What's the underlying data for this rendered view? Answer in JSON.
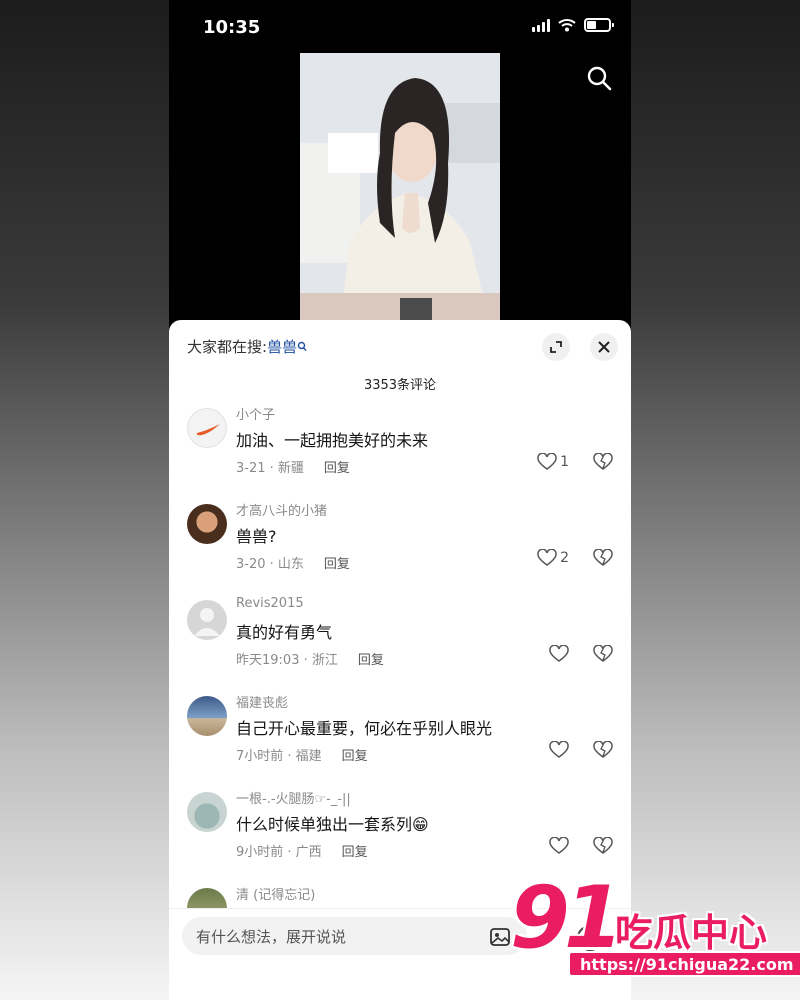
{
  "status_bar": {
    "time": "10:35"
  },
  "sheet": {
    "search_prefix": "大家都在搜:",
    "search_term": "兽兽",
    "comment_count": "3353条评论"
  },
  "comments": [
    {
      "user": "小个子",
      "text": "加油、一起拥抱美好的未来",
      "meta": "3-21 · 新疆",
      "reply": "回复",
      "likes": "1"
    },
    {
      "user": "才高八斗的小猪",
      "text": "兽兽?",
      "meta": "3-20 · 山东",
      "reply": "回复",
      "likes": "2"
    },
    {
      "user": "Revis2015",
      "text": "真的好有勇气",
      "meta": "昨天19:03 · 浙江",
      "reply": "回复",
      "likes": ""
    },
    {
      "user": "福建丧彪",
      "text": "自己开心最重要，何必在乎别人眼光",
      "meta": "7小时前 · 福建",
      "reply": "回复",
      "likes": ""
    },
    {
      "user": "一根-.-火腿肠☞-_-||",
      "text": "什么时候单独出一套系列😁",
      "meta": "9小时前 · 广西",
      "reply": "回复",
      "likes": ""
    },
    {
      "user": "清 (记得忘记)",
      "text": "",
      "meta": "",
      "reply": "",
      "likes": ""
    }
  ],
  "input": {
    "placeholder": "有什么想法，展开说说"
  },
  "watermark": {
    "big": "91",
    "name": "吃瓜中心",
    "url": "https://91chigua22.com"
  },
  "colors": {
    "accent": "#ea1d63",
    "link": "#1e4fa0",
    "sheet_bg": "#ffffff"
  },
  "icons": [
    "search-icon",
    "expand-icon",
    "close-icon",
    "heart-icon",
    "broken-heart-icon",
    "image-icon",
    "emoji-icon"
  ]
}
